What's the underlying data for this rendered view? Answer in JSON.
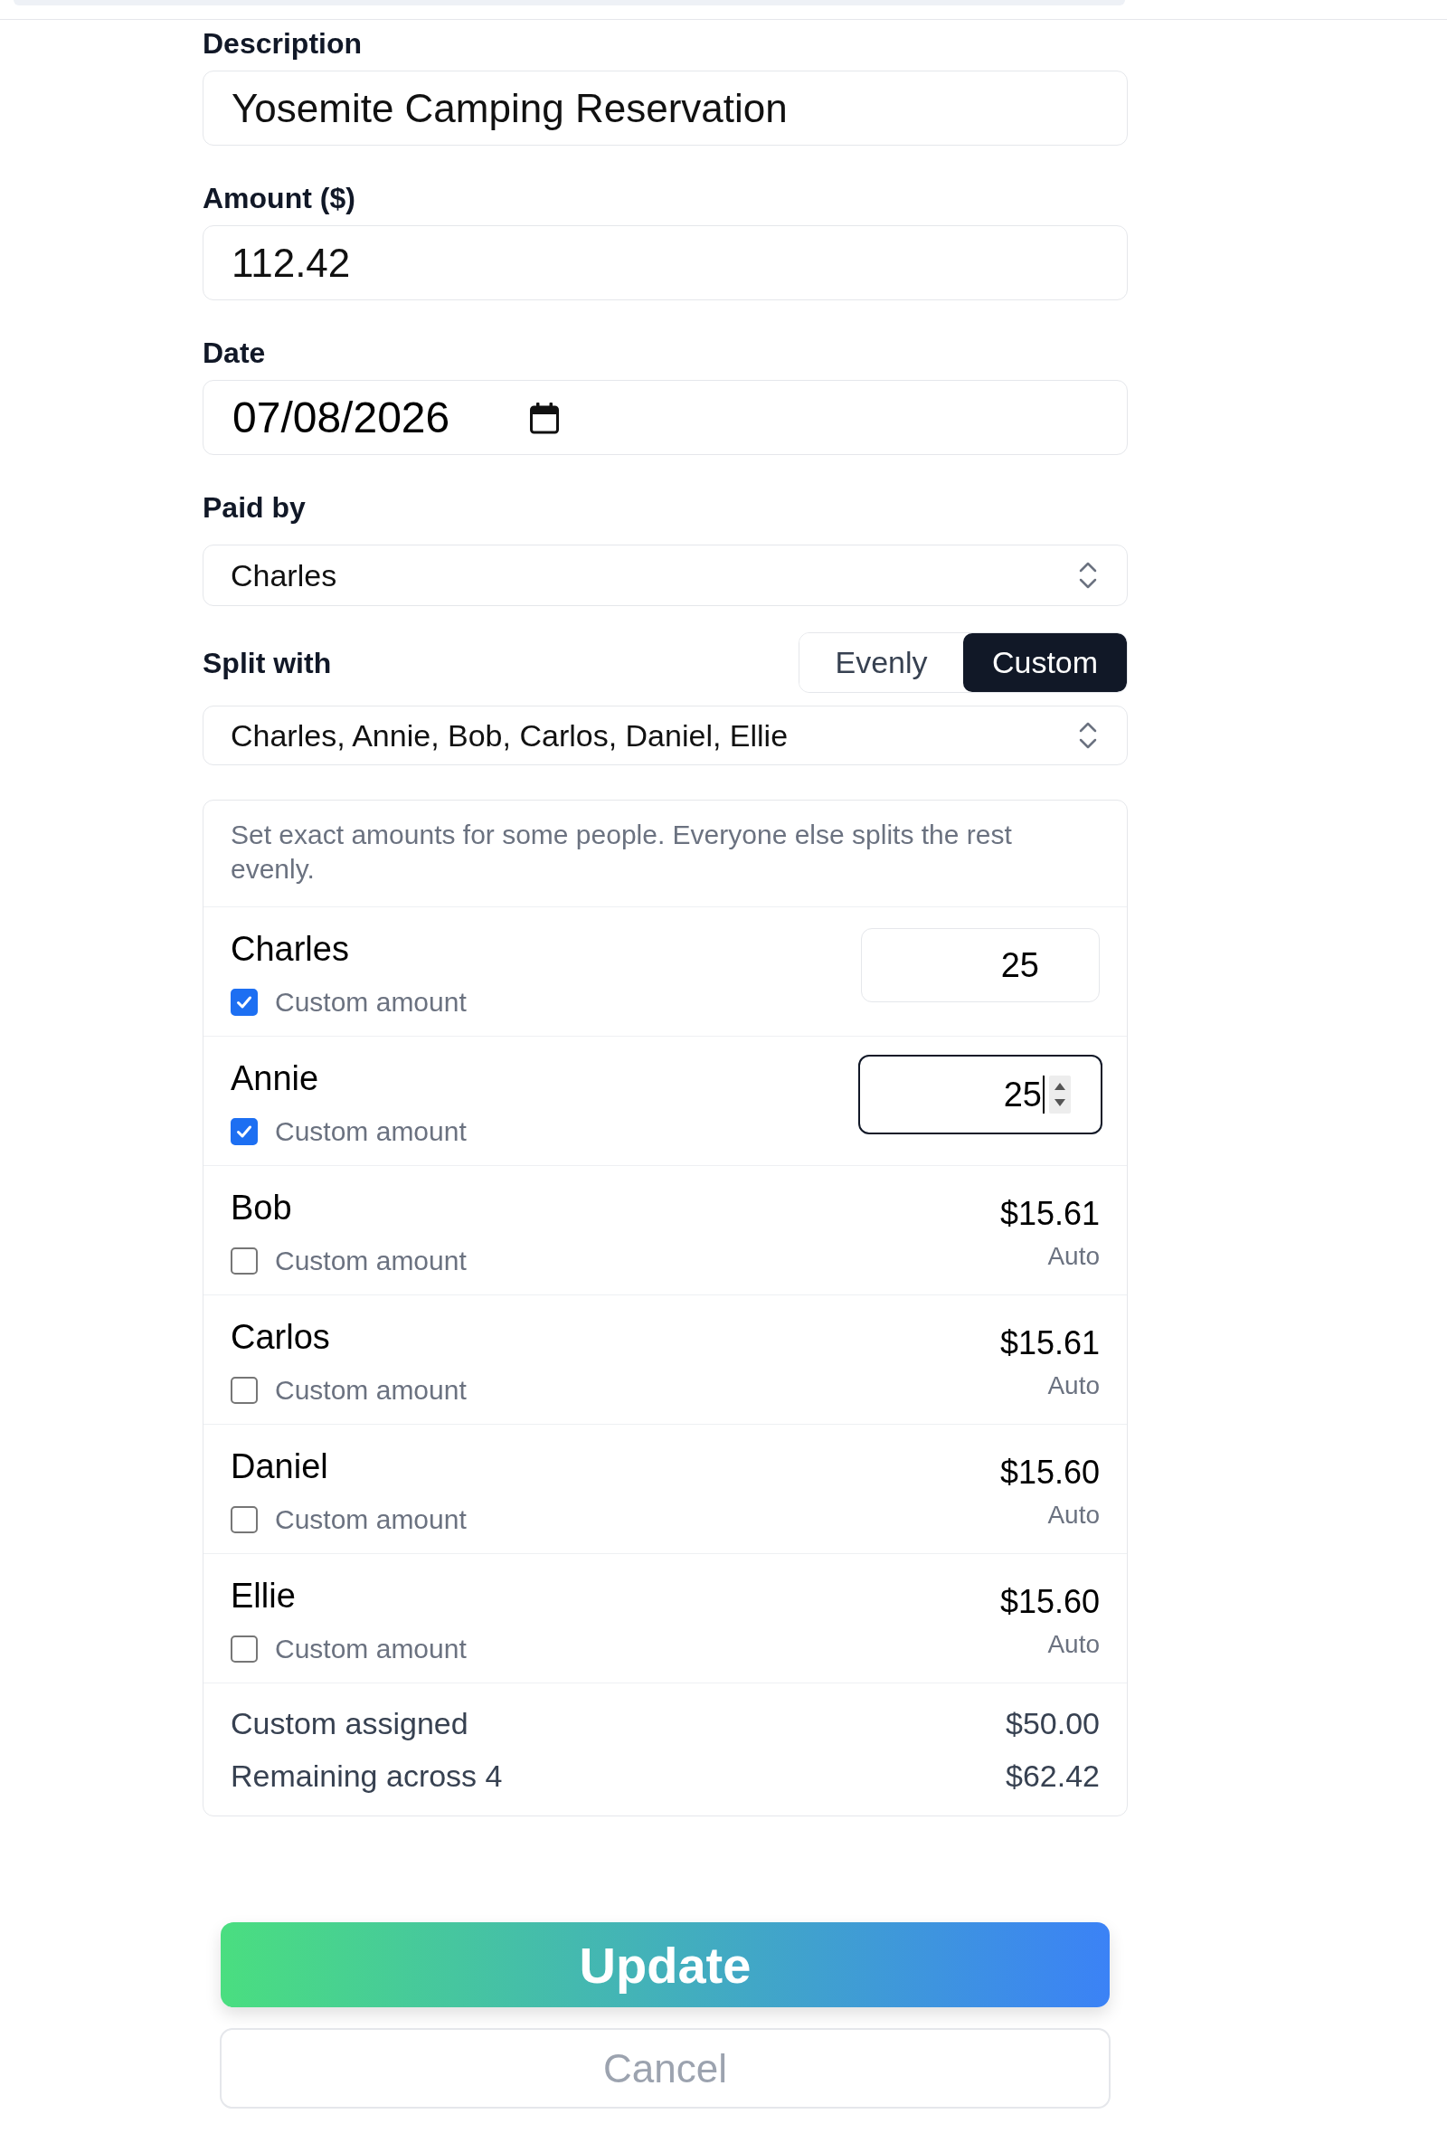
{
  "fields": [
    {
      "kind": "text",
      "label": "Description",
      "value": "Yosemite Camping Reservation"
    },
    {
      "kind": "text",
      "label": "Amount ($)",
      "value": "112.42"
    },
    {
      "kind": "date",
      "label": "Date",
      "value": "07/08/2026"
    },
    {
      "kind": "select",
      "label": "Paid by",
      "value": "Charles"
    }
  ],
  "split": {
    "label": "Split with",
    "modes": [
      {
        "label": "Evenly",
        "selected": false
      },
      {
        "label": "Custom",
        "selected": true
      }
    ],
    "value": "Charles, Annie, Bob, Carlos, Daniel, Ellie"
  },
  "custom_split": {
    "note": "Set exact amounts for some people. Everyone else splits the rest evenly.",
    "people": [
      {
        "name": "Charles",
        "checkbox_label": "Custom amount",
        "checked": true,
        "focused": false,
        "amount": "25"
      },
      {
        "name": "Annie",
        "checkbox_label": "Custom amount",
        "checked": true,
        "focused": true,
        "amount": "25"
      },
      {
        "name": "Bob",
        "checkbox_label": "Custom amount",
        "checked": false,
        "focused": false,
        "amount": "$15.61",
        "caption": "Auto"
      },
      {
        "name": "Carlos",
        "checkbox_label": "Custom amount",
        "checked": false,
        "focused": false,
        "amount": "$15.61",
        "caption": "Auto"
      },
      {
        "name": "Daniel",
        "checkbox_label": "Custom amount",
        "checked": false,
        "focused": false,
        "amount": "$15.60",
        "caption": "Auto"
      },
      {
        "name": "Ellie",
        "checkbox_label": "Custom amount",
        "checked": false,
        "focused": false,
        "amount": "$15.60",
        "caption": "Auto"
      }
    ],
    "summary": [
      {
        "label": "Custom assigned",
        "value": "$50.00"
      },
      {
        "label": "Remaining across 4",
        "value": "$62.42"
      }
    ]
  },
  "buttons": [
    {
      "kind": "primary",
      "label": "Update"
    },
    {
      "kind": "secondary",
      "label": "Cancel"
    }
  ]
}
